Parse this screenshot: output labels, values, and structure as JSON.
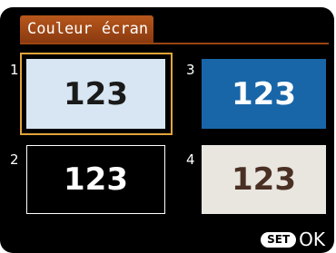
{
  "title": "Couleur écran",
  "options": [
    {
      "number": "1",
      "sample": "123",
      "background": "#d7e6f2",
      "text_color": "#1a1a1a",
      "selected": true
    },
    {
      "number": "2",
      "sample": "123",
      "background": "#000000",
      "text_color": "#ffffff",
      "selected": false
    },
    {
      "number": "3",
      "sample": "123",
      "background": "#1866a8",
      "text_color": "#ffffff",
      "selected": false
    },
    {
      "number": "4",
      "sample": "123",
      "background": "#e9e6e0",
      "text_color": "#4a3024",
      "selected": false
    }
  ],
  "footer": {
    "set_label": "SET",
    "ok_label": "OK"
  },
  "colors": {
    "title_bar": "#b8581c",
    "selection": "#e2a43a"
  }
}
